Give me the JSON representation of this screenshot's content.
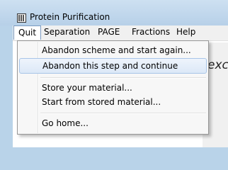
{
  "window": {
    "title": "Protein Purification",
    "icon": "app-columns-icon"
  },
  "menubar": {
    "items": [
      "Quit",
      "Separation",
      "PAGE",
      "Fractions",
      "Help"
    ],
    "active": "Quit"
  },
  "dropdown": {
    "items": [
      "Abandon scheme and start again...",
      "Abandon this step and continue",
      "Store your material...",
      "Start from stored material...",
      "Go home..."
    ],
    "highlighted": "Abandon this step and continue"
  },
  "background": {
    "partial_text": "exc"
  }
}
